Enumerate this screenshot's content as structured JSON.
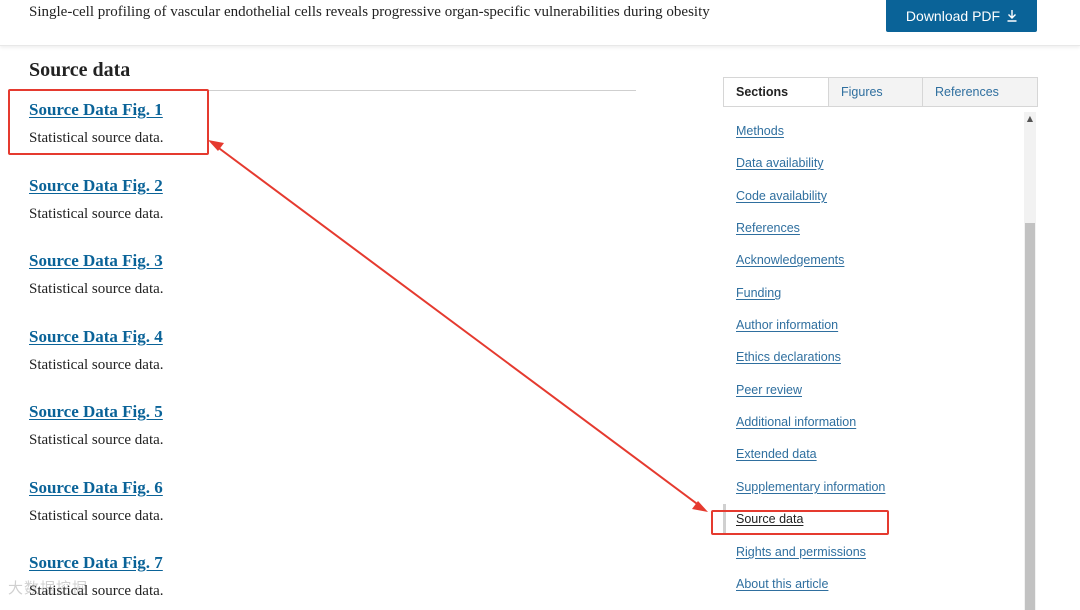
{
  "header": {
    "article_title": "Single-cell profiling of vascular endothelial cells reveals progressive organ-specific vulnerabilities during obesity",
    "download_label": "Download PDF",
    "download_icon": "download-arrow-icon"
  },
  "main": {
    "heading": "Source data",
    "items": [
      {
        "title": "Source Data Fig. 1",
        "desc": "Statistical source data."
      },
      {
        "title": "Source Data Fig. 2",
        "desc": "Statistical source data."
      },
      {
        "title": "Source Data Fig. 3",
        "desc": "Statistical source data."
      },
      {
        "title": "Source Data Fig. 4",
        "desc": "Statistical source data."
      },
      {
        "title": "Source Data Fig. 5",
        "desc": "Statistical source data."
      },
      {
        "title": "Source Data Fig. 6",
        "desc": "Statistical source data."
      },
      {
        "title": "Source Data Fig. 7",
        "desc": "Statistical source data."
      }
    ]
  },
  "sidebar": {
    "tabs": [
      {
        "label": "Sections",
        "active": true
      },
      {
        "label": "Figures",
        "active": false
      },
      {
        "label": "References",
        "active": false
      }
    ],
    "nav": [
      {
        "label": "Methods"
      },
      {
        "label": "Data availability"
      },
      {
        "label": "Code availability"
      },
      {
        "label": "References"
      },
      {
        "label": "Acknowledgements"
      },
      {
        "label": "Funding"
      },
      {
        "label": "Author information"
      },
      {
        "label": "Ethics declarations"
      },
      {
        "label": "Peer review"
      },
      {
        "label": "Additional information"
      },
      {
        "label": "Extended data"
      },
      {
        "label": "Supplementary information"
      },
      {
        "label": "Source data",
        "current": true
      },
      {
        "label": "Rights and permissions"
      },
      {
        "label": "About this article"
      }
    ]
  },
  "annotation": {
    "color": "#e53a2f"
  },
  "watermark": {
    "text": "大数据挖掘"
  },
  "colors": {
    "link": "#0a6398",
    "button_bg": "#0a6398",
    "nav_link": "#2f6f9f"
  }
}
